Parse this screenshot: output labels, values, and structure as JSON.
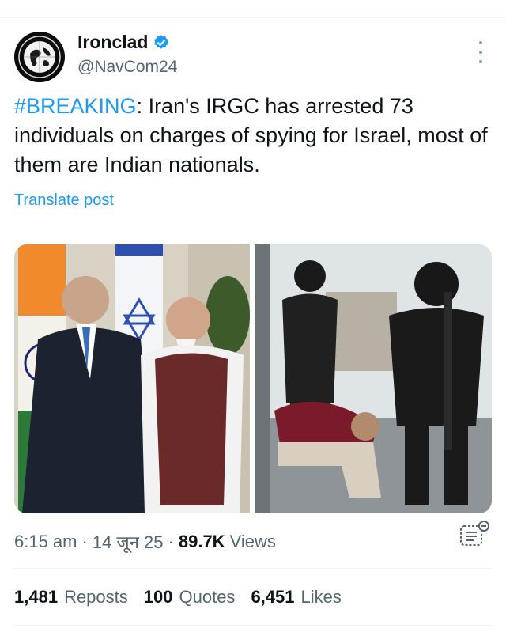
{
  "post": {
    "author_name": "Ironclad",
    "author_handle": "@NavCom24",
    "hashtag": "#BREAKING",
    "text": ": Iran's IRGC has arrested 73 individuals on charges of spying for Israel, most of them are Indian nationals.",
    "translate_label": "Translate post",
    "time": "6:15 am",
    "date": "14 जून 25",
    "views_count": "89.7K",
    "views_label": "Views"
  },
  "stats": {
    "reposts_count": "1,481",
    "reposts_label": "Reposts",
    "quotes_count": "100",
    "quotes_label": "Quotes",
    "likes_count": "6,451",
    "likes_label": "Likes"
  },
  "colors": {
    "accent": "#1d9bf0",
    "muted": "#536471",
    "text": "#0f1419"
  },
  "icons": {
    "verified": "verified-badge-icon",
    "more": "more-options-icon",
    "analytics": "analytics-icon"
  }
}
